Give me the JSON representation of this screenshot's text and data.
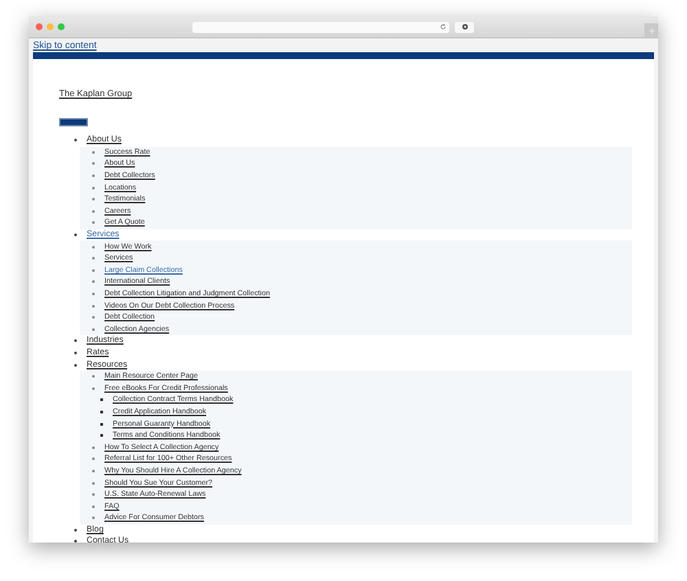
{
  "skip_link": "Skip to content",
  "site_title": "The Kaplan Group",
  "nav": {
    "items": [
      {
        "label": "About Us",
        "active": false,
        "children": [
          {
            "label": "Success Rate",
            "active": false
          },
          {
            "label": "About Us",
            "active": false
          },
          {
            "label": "Debt Collectors",
            "active": false
          },
          {
            "label": "Locations",
            "active": false
          },
          {
            "label": "Testimonials",
            "active": false
          },
          {
            "label": "Careers",
            "active": false
          },
          {
            "label": "Get A Quote",
            "active": false
          }
        ]
      },
      {
        "label": "Services",
        "active": true,
        "children": [
          {
            "label": "How We Work",
            "active": false
          },
          {
            "label": "Services",
            "active": false
          },
          {
            "label": "Large Claim Collections",
            "active": true
          },
          {
            "label": "International Clients",
            "active": false
          },
          {
            "label": "Debt Collection Litigation and Judgment Collection",
            "active": false
          },
          {
            "label": "Videos On Our Debt Collection Process",
            "active": false
          },
          {
            "label": "Debt Collection",
            "active": false
          },
          {
            "label": "Collection Agencies",
            "active": false
          }
        ]
      },
      {
        "label": "Industries",
        "active": false
      },
      {
        "label": "Rates",
        "active": false
      },
      {
        "label": "Resources",
        "active": false,
        "children": [
          {
            "label": "Main Resource Center Page",
            "active": false
          },
          {
            "label": "Free eBooks For Credit Professionals",
            "active": false,
            "children": [
              {
                "label": "Collection Contract Terms Handbook",
                "active": false
              },
              {
                "label": "Credit Application Handbook",
                "active": false
              },
              {
                "label": "Personal Guaranty Handbook",
                "active": false
              },
              {
                "label": "Terms and Conditions Handbook",
                "active": false
              }
            ]
          },
          {
            "label": "How To Select A Collection Agency",
            "active": false
          },
          {
            "label": "Referral List for 100+ Other Resources",
            "active": false
          },
          {
            "label": "Why You Should Hire A Collection Agency",
            "active": false
          },
          {
            "label": "Should You Sue Your Customer?",
            "active": false
          },
          {
            "label": "U.S. State Auto-Renewal Laws",
            "active": false
          },
          {
            "label": "FAQ",
            "active": false
          },
          {
            "label": "Advice For Consumer Debtors",
            "active": false
          }
        ]
      },
      {
        "label": "Blog",
        "active": false
      },
      {
        "label": "Contact Us",
        "active": false
      }
    ]
  }
}
